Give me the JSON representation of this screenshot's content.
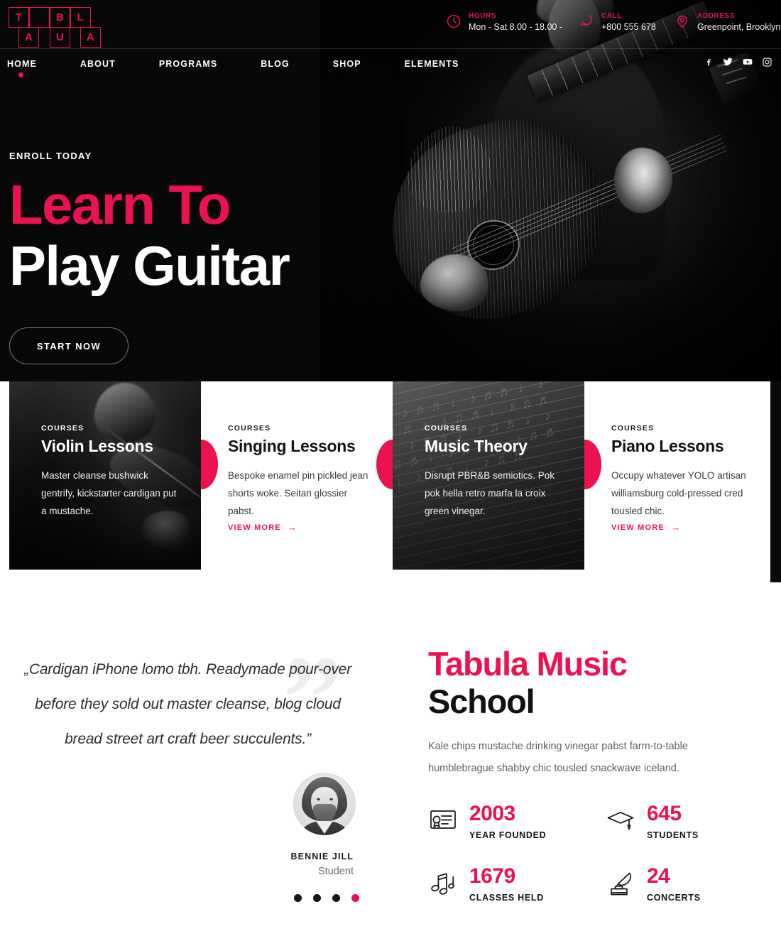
{
  "brand": {
    "accent": "#ec1250",
    "logo_rows": [
      [
        {
          "letter": "T",
          "filled": true
        },
        {
          "letter": "",
          "filled": false
        },
        {
          "letter": "B",
          "filled": true
        },
        {
          "letter": "",
          "filled": false
        },
        {
          "letter": "L",
          "filled": true
        }
      ],
      [
        {
          "letter": "",
          "filled": false
        },
        {
          "letter": "A",
          "filled": true
        },
        {
          "letter": "",
          "filled": false
        },
        {
          "letter": "U",
          "filled": true
        },
        {
          "letter": "",
          "filled": false
        },
        {
          "letter": "A",
          "filled": true
        }
      ]
    ],
    "logo_text": "TABULA"
  },
  "header": {
    "contacts": [
      {
        "icon": "clock-icon",
        "label": "HOURS",
        "value": "Mon - Sat 8.00 - 18.00 -"
      },
      {
        "icon": "phone-icon",
        "label": "CALL",
        "value": "+800 555 678"
      },
      {
        "icon": "location-icon",
        "label": "ADDRESS",
        "value": "Greenpoint, Brooklyn"
      }
    ]
  },
  "nav": {
    "items": [
      {
        "label": "HOME",
        "active": true
      },
      {
        "label": "ABOUT",
        "active": false
      },
      {
        "label": "PROGRAMS",
        "active": false
      },
      {
        "label": "BLOG",
        "active": false
      },
      {
        "label": "SHOP",
        "active": false
      },
      {
        "label": "ELEMENTS",
        "active": false
      }
    ],
    "social": [
      {
        "icon": "facebook-icon",
        "name": "Facebook"
      },
      {
        "icon": "twitter-icon",
        "name": "Twitter"
      },
      {
        "icon": "youtube-icon",
        "name": "YouTube"
      },
      {
        "icon": "instagram-icon",
        "name": "Instagram"
      }
    ]
  },
  "hero": {
    "eyebrow": "ENROLL TODAY",
    "title_line1": "Learn To",
    "title_line2": "Play Guitar",
    "cta": "START NOW"
  },
  "courses": {
    "more_label": "VIEW MORE",
    "arrow": "→",
    "items": [
      {
        "kicker": "COURSES",
        "title": "Violin Lessons",
        "desc": "Master cleanse bushwick gentrify, kickstarter cardigan put a mustache."
      },
      {
        "kicker": "COURSES",
        "title": "Singing Lessons",
        "desc": "Bespoke enamel pin pickled jean shorts woke. Seitan glossier pabst."
      },
      {
        "kicker": "COURSES",
        "title": "Music Theory",
        "desc": "Disrupt PBR&B semiotics. Pok pok hella retro marfa la croix green vinegar."
      },
      {
        "kicker": "COURSES",
        "title": "Piano Lessons",
        "desc": "Occupy whatever YOLO artisan williamsburg cold-pressed cred tousled chic."
      }
    ]
  },
  "testimonial": {
    "quote_glyph": "”",
    "quote": "„Cardigan iPhone lomo tbh. Readymade pour-over before they sold out master cleanse, blog cloud bread street art craft beer succulents.”",
    "author": "BENNIE JILL",
    "role": "Student",
    "dots_count": 4,
    "active_dot": 3
  },
  "about": {
    "title_pink": "Tabula Music",
    "title_dark": "School",
    "desc": "Kale chips mustache drinking vinegar pabst farm-to-table humblebrague shabby chic tousled snackwave iceland.",
    "stats": [
      {
        "icon": "certificate-icon",
        "value": "2003",
        "label": "YEAR FOUNDED"
      },
      {
        "icon": "graduation-icon",
        "value": "645",
        "label": "STUDENTS"
      },
      {
        "icon": "music-notes-icon",
        "value": "1679",
        "label": "CLASSES HELD"
      },
      {
        "icon": "gramophone-icon",
        "value": "24",
        "label": "CONCERTS"
      }
    ]
  }
}
